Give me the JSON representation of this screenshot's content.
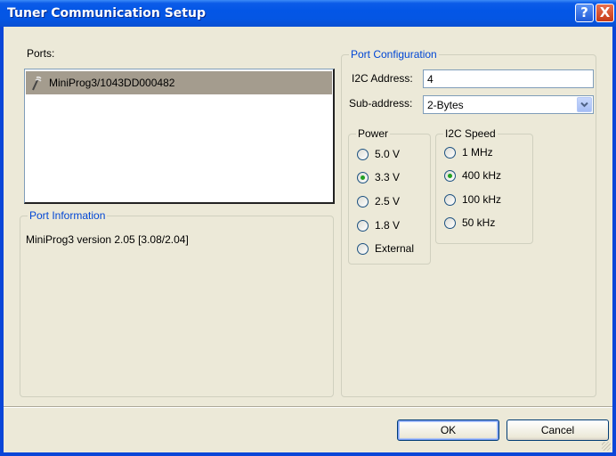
{
  "window": {
    "title": "Tuner Communication Setup",
    "help_label": "?",
    "close_label": "X",
    "colors": {
      "titlebar": "#0356e6",
      "face": "#ece9d8",
      "group_title": "#0046d5"
    }
  },
  "ports": {
    "label": "Ports:",
    "items": [
      {
        "label": "MiniProg3/1043DD000482",
        "icon": "probe-icon",
        "selected": true
      }
    ]
  },
  "port_information": {
    "title": "Port Information",
    "text": "MiniProg3 version 2.05 [3.08/2.04]"
  },
  "port_configuration": {
    "title": "Port Configuration",
    "i2c_address": {
      "label": "I2C Address:",
      "value": "4"
    },
    "sub_address": {
      "label": "Sub-address:",
      "value": "2-Bytes"
    },
    "power": {
      "title": "Power",
      "options": [
        {
          "label": "5.0 V",
          "checked": false
        },
        {
          "label": "3.3 V",
          "checked": true
        },
        {
          "label": "2.5 V",
          "checked": false
        },
        {
          "label": "1.8 V",
          "checked": false
        },
        {
          "label": "External",
          "checked": false
        }
      ]
    },
    "i2c_speed": {
      "title": "I2C Speed",
      "options": [
        {
          "label": "1 MHz",
          "checked": false
        },
        {
          "label": "400 kHz",
          "checked": true
        },
        {
          "label": "100 kHz",
          "checked": false
        },
        {
          "label": "50 kHz",
          "checked": false
        }
      ]
    }
  },
  "buttons": {
    "ok": "OK",
    "cancel": "Cancel"
  }
}
